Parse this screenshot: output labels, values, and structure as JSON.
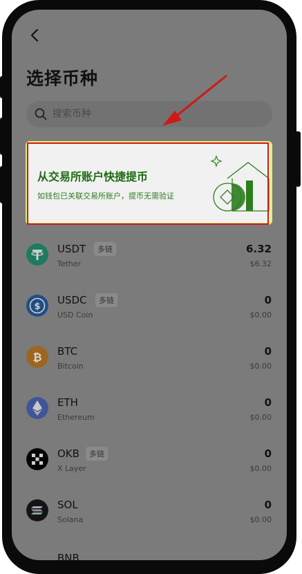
{
  "page": {
    "title": "选择币种"
  },
  "search": {
    "placeholder": "搜索币种"
  },
  "banner": {
    "title": "从交易所账户快捷提币",
    "subtitle": "如钱包已关联交易所账户，提币无需验证",
    "accent_color": "#1f6b14"
  },
  "coins": [
    {
      "symbol": "USDT",
      "name": "Tether",
      "chain_badge": "多链",
      "amount": "6.32",
      "usd": "$6.32",
      "icon": "tether-icon",
      "color": "#26a17b"
    },
    {
      "symbol": "USDC",
      "name": "USD Coin",
      "chain_badge": "多链",
      "amount": "0",
      "usd": "$0.00",
      "icon": "usdc-icon",
      "color": "#2775ca"
    },
    {
      "symbol": "BTC",
      "name": "Bitcoin",
      "chain_badge": "",
      "amount": "0",
      "usd": "$0.00",
      "icon": "bitcoin-icon",
      "color": "#f7931a"
    },
    {
      "symbol": "ETH",
      "name": "Ethereum",
      "chain_badge": "",
      "amount": "0",
      "usd": "$0.00",
      "icon": "ethereum-icon",
      "color": "#627eea"
    },
    {
      "symbol": "OKB",
      "name": "X Layer",
      "chain_badge": "多链",
      "amount": "0",
      "usd": "$0.00",
      "icon": "okb-icon",
      "color": "#000000"
    },
    {
      "symbol": "SOL",
      "name": "Solana",
      "chain_badge": "",
      "amount": "0",
      "usd": "$0.00",
      "icon": "solana-icon",
      "color": "#1a1a1a"
    }
  ],
  "partial_row": {
    "symbol": "BNB"
  },
  "colors": {
    "overlay": "#7b7b7b",
    "highlight_border": "#d01818",
    "annotation_arrow": "#d01818"
  }
}
